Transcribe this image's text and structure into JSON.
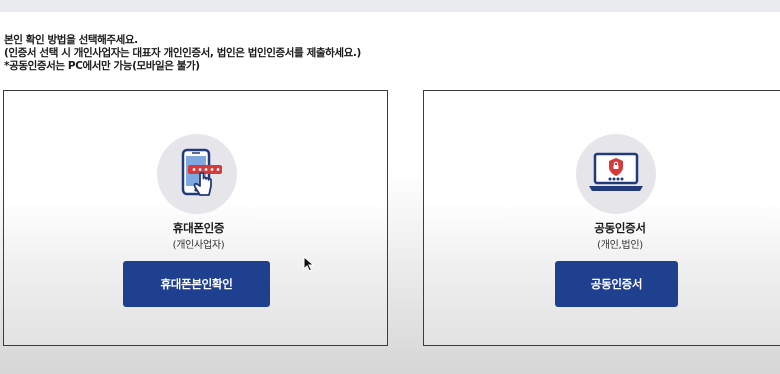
{
  "instructions": {
    "line1": "본인 확인 방법을 선택해주세요.",
    "line2": "(인증서 선택 시 개인사업자는 대표자 개인인증서, 법인은 법인인증서를 제출하세요.)",
    "line3": "*공동인증서는 PC에서만 가능(모바일은 불가)"
  },
  "options": {
    "phone": {
      "title": "휴대폰인증",
      "subtitle": "(개인사업자)",
      "button": "휴대폰본인확인",
      "icon": "phone-verification-icon"
    },
    "cert": {
      "title": "공동인증서",
      "subtitle": "(개인,법인)",
      "button": "공동인증서",
      "icon": "laptop-certificate-icon"
    }
  },
  "colors": {
    "button_bg": "#1f3f8f",
    "icon_circle_bg": "#e6e6ea",
    "icon_navy": "#233a7a",
    "icon_red": "#d63a3a"
  }
}
